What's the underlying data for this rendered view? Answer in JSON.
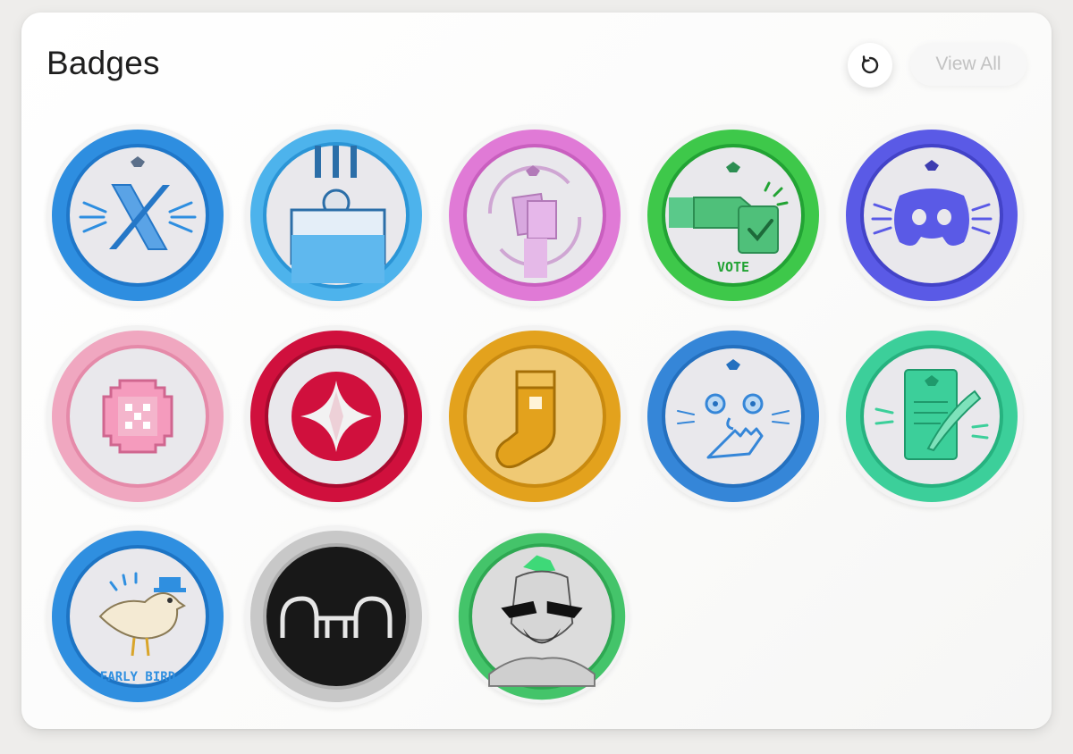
{
  "header": {
    "title": "Badges",
    "view_all_label": "View All",
    "refresh_icon": "refresh-icon"
  },
  "badges": [
    {
      "id": "x",
      "icon": "x-logo-icon",
      "ring": "#2e8ee0"
    },
    {
      "id": "ballot",
      "icon": "ballot-box-icon",
      "ring": "#4db3ec"
    },
    {
      "id": "cards",
      "icon": "card-swap-icon",
      "ring": "#e07ad6"
    },
    {
      "id": "vote",
      "icon": "vote-hand-icon",
      "ring": "#3ec84a",
      "label": "VOTE"
    },
    {
      "id": "discord",
      "icon": "discord-logo-icon",
      "ring": "#5a5ae6"
    },
    {
      "id": "pixel",
      "icon": "pixel-button-icon",
      "ring": "#f0a7c0"
    },
    {
      "id": "star",
      "icon": "four-point-star-icon",
      "ring": "#d0103d"
    },
    {
      "id": "sock",
      "icon": "sock-icon",
      "ring": "#e3a21d"
    },
    {
      "id": "face",
      "icon": "surprised-face-icon",
      "ring": "#3586d8"
    },
    {
      "id": "quill",
      "icon": "document-quill-icon",
      "ring": "#3ccf9a"
    },
    {
      "id": "earlybird",
      "icon": "early-bird-icon",
      "ring": "#2f8fe0",
      "label": "EARLY BIRD"
    },
    {
      "id": "arch",
      "icon": "arch-logo-icon",
      "ring": "#c8c8c8"
    },
    {
      "id": "character",
      "icon": "mohawk-character-icon",
      "ring": "#44c46a"
    }
  ]
}
